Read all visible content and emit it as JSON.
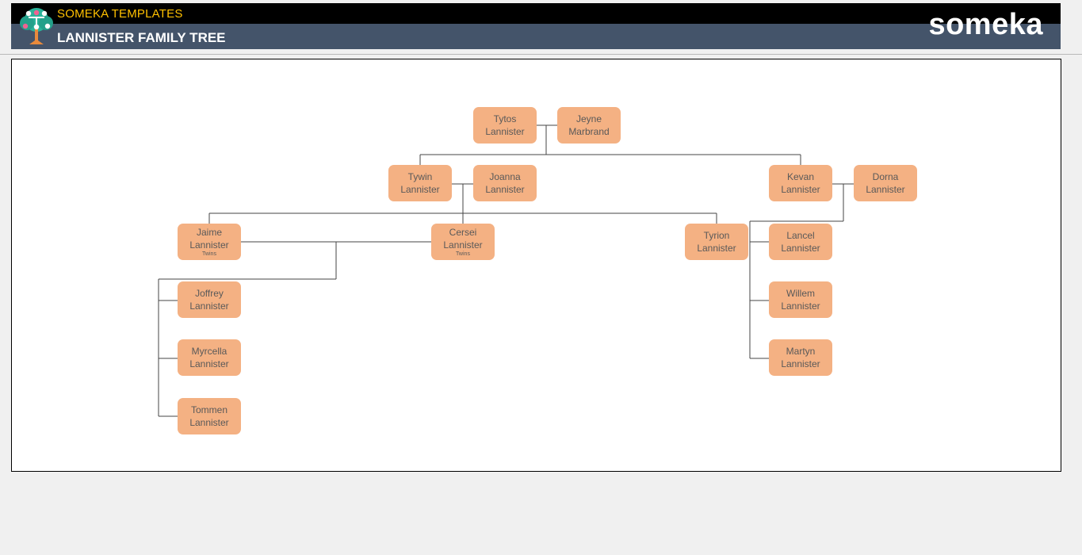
{
  "header": {
    "brand": "SOMEKA TEMPLATES",
    "title": "LANNISTER FAMILY TREE",
    "wordmark": "someka",
    "colors": {
      "top_bar": "#000000",
      "bottom_bar": "#44546a",
      "brand_text": "#ffc000"
    }
  },
  "tree": {
    "node_color": "#f4b183",
    "members": {
      "tytos": {
        "first": "Tytos",
        "last": "Lannister"
      },
      "jeyne": {
        "first": "Jeyne",
        "last": "Marbrand"
      },
      "tywin": {
        "first": "Tywin",
        "last": "Lannister"
      },
      "joanna": {
        "first": "Joanna",
        "last": "Lannister"
      },
      "kevan": {
        "first": "Kevan",
        "last": "Lannister"
      },
      "dorna": {
        "first": "Dorna",
        "last": "Lannister"
      },
      "jaime": {
        "first": "Jaime",
        "last": "Lannister",
        "note": "Twins"
      },
      "cersei": {
        "first": "Cersei",
        "last": "Lannister",
        "note": "Twins"
      },
      "tyrion": {
        "first": "Tyrion",
        "last": "Lannister"
      },
      "lancel": {
        "first": "Lancel",
        "last": "Lannister"
      },
      "willem": {
        "first": "Willem",
        "last": "Lannister"
      },
      "martyn": {
        "first": "Martyn",
        "last": "Lannister"
      },
      "joffrey": {
        "first": "Joffrey",
        "last": "Lannister"
      },
      "myrcella": {
        "first": "Myrcella",
        "last": "Lannister"
      },
      "tommen": {
        "first": "Tommen",
        "last": "Lannister"
      }
    }
  }
}
